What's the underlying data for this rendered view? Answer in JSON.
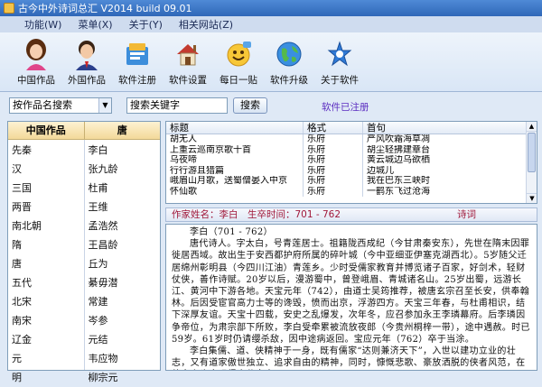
{
  "window": {
    "title": "古今中外诗词总汇 V2014 build 09.01"
  },
  "menu": [
    "功能(W)",
    "菜单(X)",
    "关于(Y)",
    "相关网站(Z)"
  ],
  "toolbar": [
    {
      "label": "中国作品",
      "icon": "chinese-woman-avatar-icon"
    },
    {
      "label": "外国作品",
      "icon": "foreign-man-avatar-icon"
    },
    {
      "label": "软件注册",
      "icon": "register-box-icon"
    },
    {
      "label": "软件设置",
      "icon": "house-settings-icon"
    },
    {
      "label": "每日一贴",
      "icon": "smiley-face-icon"
    },
    {
      "label": "软件升级",
      "icon": "globe-icon"
    },
    {
      "label": "关于软件",
      "icon": "star-wings-icon"
    }
  ],
  "search": {
    "mode": "按作品名搜索",
    "keyword_placeholder": "搜索关键字",
    "button": "搜索",
    "status": "软件已注册"
  },
  "left": {
    "header1": "中国作品",
    "header2": "唐",
    "dynasties": [
      "先秦",
      "汉",
      "三国",
      "两晋",
      "南北朝",
      "隋",
      "唐",
      "五代",
      "北宋",
      "南宋",
      "辽金",
      "元",
      "明"
    ],
    "poets": [
      "李白",
      "张九龄",
      "杜甫",
      "王维",
      "孟浩然",
      "王昌龄",
      "丘为",
      "綦毋潜",
      "常建",
      "岑参",
      "元结",
      "韦应物",
      "柳宗元"
    ]
  },
  "grid": {
    "headers": [
      "标题",
      "格式",
      "首句"
    ],
    "rows": [
      [
        "胡无人",
        "乐府",
        "严风吹霜海草凋"
      ],
      [
        "上重云巡南京歌十首",
        "乐府",
        "胡尘轻拂建章台"
      ],
      [
        "乌夜啼",
        "乐府",
        "黄云城边乌欲栖"
      ],
      [
        "行行游且猎篇",
        "乐府",
        "边城儿"
      ],
      [
        "峨眉山月歌，送蜀僧晏入中京",
        "乐府",
        "我在巴东三峡时"
      ],
      [
        "怀仙歌",
        "乐府",
        "一鹤东飞过沧海"
      ]
    ]
  },
  "info": {
    "author_label": "作家姓名：李白",
    "time_label": "生卒时间：701 - 762",
    "genre": "诗词"
  },
  "bio": [
    "李白（701 - 762）",
    "唐代诗人。字太白，号青莲居士。祖籍陇西成纪（今甘肃秦安东），先世在隋末因罪徙居西域。故出生于安西都护府所属的碎叶城（今中亚细亚伊塞克湖西北）。5岁随父迁居绵州彰明县（今四川江油）青莲乡。少时受儒家教育并博览诸子百家，好剑术，轻财仗侠，善作诗赋。20岁以后，漫游蜀中，曾登峨眉、青城诸名山。25岁出蜀，远游长江、黄河中下游各地。天宝元年（742），由道士吴筠推荐，被唐玄宗召至长安，供奉翰林。后因受宦官高力士等的谗毁，愤而出京，浮游四方。天宝三年春，与杜甫相识，结下深厚友谊。天宝十四载，安史之乱爆发，次年冬，应召参加永王李璘幕府。后李璘因争帝位，为肃宗部下所败，李白受牵累被流放夜郎（今贵州桐梓一带），途中遇赦。时已59岁。61岁时仍请缨杀敌，因中途病返回。宝应元年（762）卒于当涂。",
    "李白集儒、道、侠精神于一身，既有儒家“达则兼济天下”，入世以建功立业的壮志，又有道家傲世独立、追求自由的精神，同时，慷慨悲歌、豪放洒脱的侠者风范，在他身上也表现得十分突出。"
  ]
}
